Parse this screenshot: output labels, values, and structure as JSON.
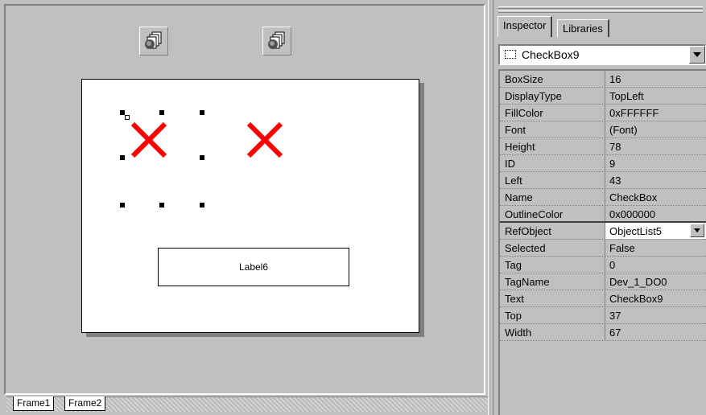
{
  "frame_tabs": [
    {
      "label": "Frame1"
    },
    {
      "label": "Frame2"
    }
  ],
  "canvas": {
    "label_text": "Label6"
  },
  "toolbar_icons": [
    {
      "icon": "object-library-icon"
    },
    {
      "icon": "object-library-icon"
    }
  ],
  "inspector": {
    "tabs": [
      {
        "label": "Inspector",
        "active": true
      },
      {
        "label": "Libraries",
        "active": false
      }
    ],
    "selected_object": "CheckBox9",
    "properties": [
      {
        "name": "BoxSize",
        "value": "16"
      },
      {
        "name": "DisplayType",
        "value": "TopLeft"
      },
      {
        "name": "FillColor",
        "value": "0xFFFFFF"
      },
      {
        "name": "Font",
        "value": "(Font)"
      },
      {
        "name": "Height",
        "value": "78"
      },
      {
        "name": "ID",
        "value": "9"
      },
      {
        "name": "Left",
        "value": "43"
      },
      {
        "name": "Name",
        "value": "CheckBox"
      },
      {
        "name": "OutlineColor",
        "value": "0x000000"
      },
      {
        "name": "RefObject",
        "value": "ObjectList5"
      },
      {
        "name": "Selected",
        "value": "False"
      },
      {
        "name": "Tag",
        "value": "0"
      },
      {
        "name": "TagName",
        "value": "Dev_1_DO0"
      },
      {
        "name": "Text",
        "value": "CheckBox9"
      },
      {
        "name": "Top",
        "value": "37"
      },
      {
        "name": "Width",
        "value": "67"
      }
    ]
  },
  "colors": {
    "x_mark": "#ff0000",
    "panel": "#c0c0c0",
    "canvas": "#ffffff"
  }
}
